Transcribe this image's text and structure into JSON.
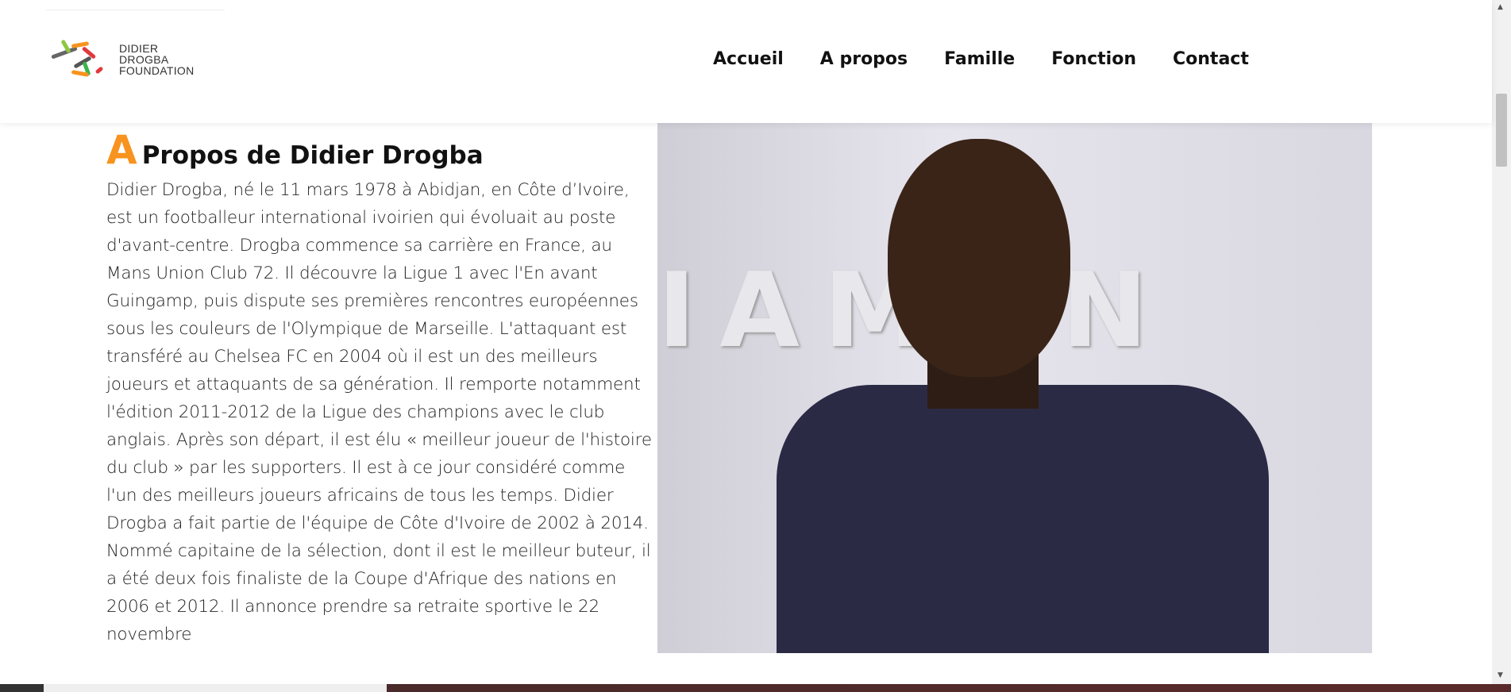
{
  "header": {
    "logo_lines": [
      "DIDIER",
      "DROGBA",
      "FOUNDATION"
    ],
    "nav": [
      "Accueil",
      "A propos",
      "Famille",
      "Fonction",
      "Contact"
    ]
  },
  "main": {
    "title_initial": "A",
    "title_rest": "Propos de Didier Drogba",
    "paragraph": "Didier Drogba, né le 11 mars 1978 à Abidjan, en Côte d’Ivoire, est un footballeur international ivoirien qui évoluait au poste d'avant-centre. Drogba commence sa carrière en France, au Mans Union Club 72. Il découvre la Ligue 1 avec l'En avant Guingamp, puis dispute ses premières rencontres européennes sous les couleurs de l'Olympique de Marseille. L'attaquant est transféré au Chelsea FC en 2004 où il est un des meilleurs joueurs et attaquants de sa génération. Il remporte notamment l'édition 2011-2012 de la Ligue des champions avec le club anglais. Après son départ, il est élu « meilleur joueur de l'histoire du club » par les supporters. Il est à ce jour considéré comme l'un des meilleurs joueurs africains de tous les temps. Didier Drogba a fait partie de l'équipe de Côte d'Ivoire de 2002 à 2014. Nommé capitaine de la sélection, dont il est le meilleur buteur, il a été deux fois finaliste de la Coupe d'Afrique des nations en 2006 et 2012. Il annonce prendre sa retraite sportive le 22 novembre",
    "accent_color": "#f7931e"
  }
}
